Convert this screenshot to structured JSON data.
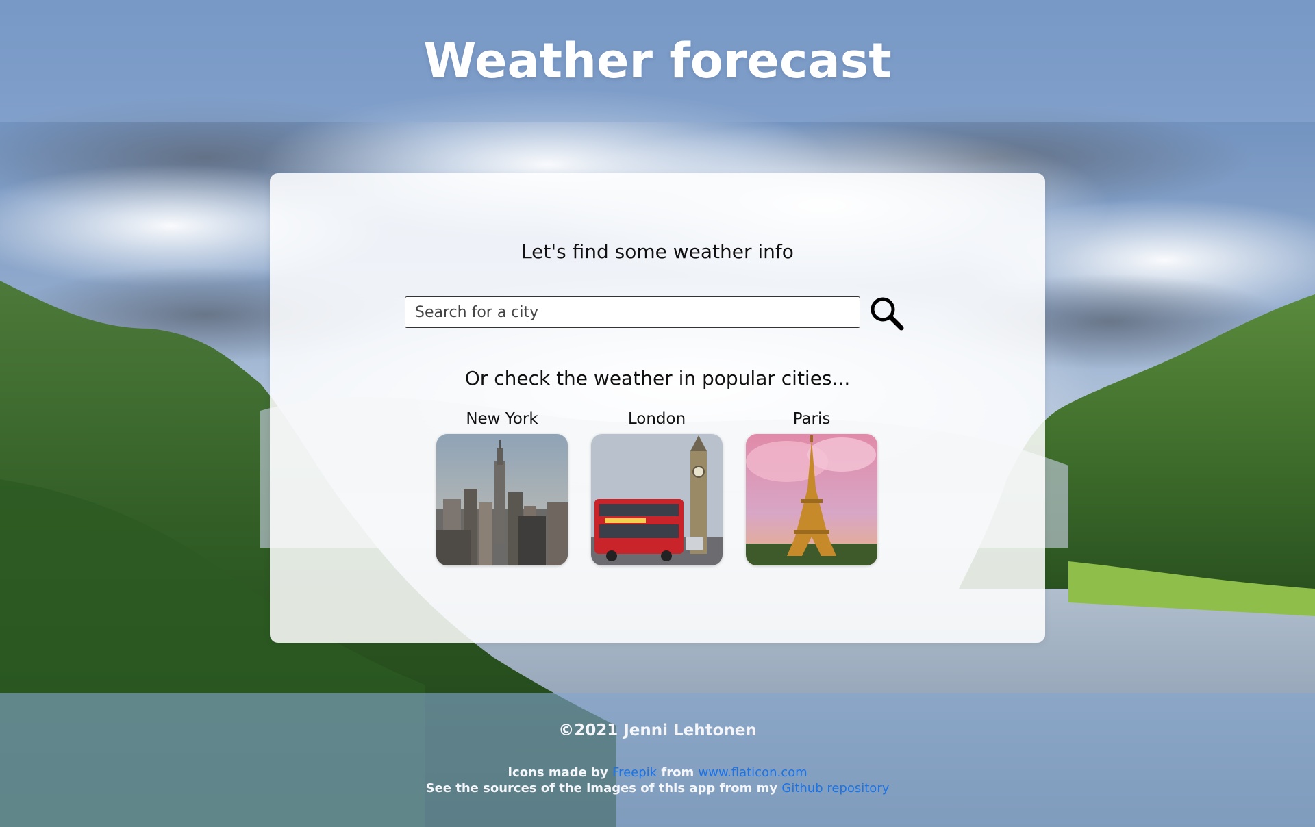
{
  "header": {
    "title": "Weather forecast"
  },
  "main": {
    "intro": "Let's find some weather info",
    "search": {
      "placeholder": "Search for a city",
      "value": "",
      "button_icon": "search-icon"
    },
    "popular_title": "Or check the weather in popular cities...",
    "cities": [
      {
        "label": "New York",
        "image": "new-york-skyline-image"
      },
      {
        "label": "London",
        "image": "london-bus-big-ben-image"
      },
      {
        "label": "Paris",
        "image": "paris-eiffel-tower-image"
      }
    ]
  },
  "footer": {
    "copyright": "©2021 Jenni Lehtonen",
    "icons_prefix": "Icons made by",
    "icons_author_link": "Freepik",
    "icons_from": "from",
    "icons_site_link": "www.flaticon.com",
    "sources_text": "See the sources of the images of this app from my",
    "sources_link": "Github repository"
  },
  "colors": {
    "header_overlay": "#8caad2",
    "card_background": "#ffffff",
    "link": "#1a73e8",
    "text": "#111111",
    "footer_text": "#f4f6fa"
  }
}
